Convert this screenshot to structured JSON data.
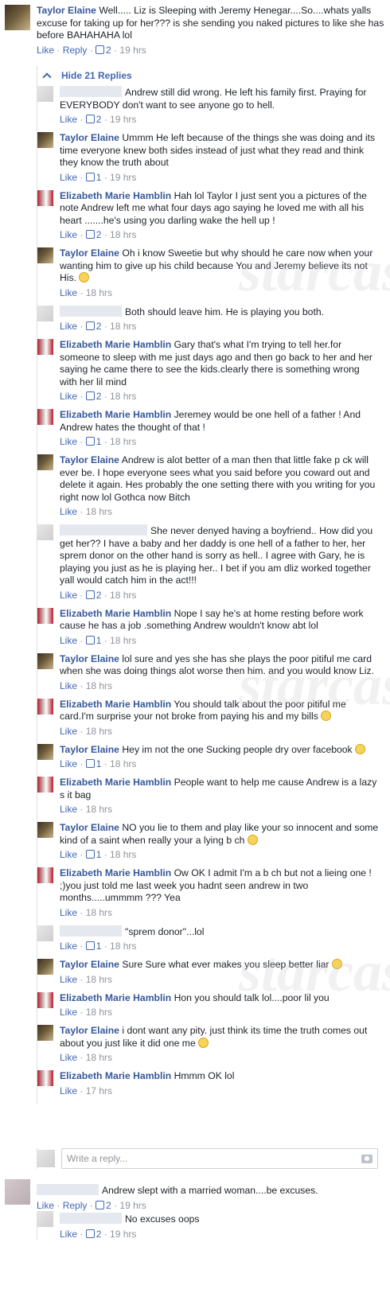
{
  "top_comment": {
    "author": "Taylor Elaine",
    "text": "Well..... Liz is Sleeping with Jeremy Henegar....So....whats yalls excuse for taking up for her??? is she sending you naked pictures to like she has before BAHAHAHA lol",
    "like": "Like",
    "reply": "Reply",
    "likes": "2",
    "time": "19 hrs"
  },
  "hide_replies": "Hide 21 Replies",
  "replies": [
    {
      "author": "",
      "blur": true,
      "text": "Andrew still did wrong. He left his family first. Praying for EVERYBODY don't want to see anyone go to hell.",
      "likes": "2",
      "time": "19 hrs"
    },
    {
      "author": "Taylor Elaine",
      "avatar": "taylor",
      "text": "Ummm He left because of the things she was doing and its time everyone knew both sides instead of just what they read and think they know the truth about",
      "likes": "1",
      "time": "19 hrs"
    },
    {
      "author": "Elizabeth Marie Hamblin",
      "avatar": "eliz",
      "text": "Hah lol Taylor I just sent you a pictures of the note Andrew left me what four days ago saying he loved me with all his heart .......he's using you darling wake the hell up !",
      "likes": "2",
      "time": "18 hrs"
    },
    {
      "author": "Taylor Elaine",
      "avatar": "taylor",
      "text": "Oh i know Sweetie but why should he care now when your wanting him to give up his child because You and Jeremy believe its not His.",
      "emoji": true,
      "likes": "",
      "time": "18 hrs"
    },
    {
      "author": "",
      "blur": true,
      "text": "Both should leave him. He is playing you both.",
      "likes": "2",
      "time": "18 hrs"
    },
    {
      "author": "Elizabeth Marie Hamblin",
      "avatar": "eliz",
      "text": "Gary that's what I'm trying to tell her.for someone to sleep with me just days ago and then go back to her and her saying he came there to see the kids.clearly there is something wrong with her lil mind",
      "likes": "2",
      "time": "18 hrs"
    },
    {
      "author": "Elizabeth Marie Hamblin",
      "avatar": "eliz",
      "text": "Jeremey would be one hell of a father ! And Andrew hates the thought of that !",
      "likes": "1",
      "time": "18 hrs"
    },
    {
      "author": "Taylor Elaine",
      "avatar": "taylor",
      "text": "Andrew is alot better of a man then that little fake p ck will ever be. I hope everyone sees what you said before you coward out and delete it again. Hes probably the one setting there with you writing for you right now lol Gothca now Bitch",
      "likes": "",
      "time": "18 hrs"
    },
    {
      "author": "",
      "blur": true,
      "wide": true,
      "text": "She never denyed having a boyfriend.. How did you get her?? I have a baby and her daddy is one hell of a father to her, her sprem donor on the other hand is sorry as hell.. I agree with Gary, he is playing you just as he is playing her.. I bet if you am dliz worked together yall would catch him in the act!!!",
      "likes": "2",
      "time": "18 hrs"
    },
    {
      "author": "Elizabeth Marie Hamblin",
      "avatar": "eliz",
      "text": "Nope I say he's at home resting before work cause he has a job .something Andrew wouldn't know abt lol",
      "likes": "1",
      "time": "18 hrs"
    },
    {
      "author": "Taylor Elaine",
      "avatar": "taylor",
      "text": "lol sure and yes she has she plays the poor pitiful me card when she was doing things alot worse then him. and you would know Liz.",
      "likes": "",
      "time": "18 hrs"
    },
    {
      "author": "Elizabeth Marie Hamblin",
      "avatar": "eliz",
      "text": "You should talk about the poor pitiful me card.I'm surprise your not broke from paying his and my bills",
      "emoji": true,
      "likes": "",
      "time": "18 hrs"
    },
    {
      "author": "Taylor Elaine",
      "avatar": "taylor",
      "text": "Hey im not the one Sucking people dry over facebook",
      "emoji": true,
      "likes": "1",
      "time": "18 hrs"
    },
    {
      "author": "Elizabeth Marie Hamblin",
      "avatar": "eliz",
      "text": "People want to help me cause Andrew is a lazy s it bag",
      "likes": "",
      "time": "18 hrs"
    },
    {
      "author": "Taylor Elaine",
      "avatar": "taylor",
      "text": "NO you lie to them and play like your so innocent and some kind of a saint when really your a lying b ch",
      "emoji": true,
      "likes": "1",
      "time": "18 hrs"
    },
    {
      "author": "Elizabeth Marie Hamblin",
      "avatar": "eliz",
      "text": "Ow OK I admit I'm a b ch but not a lieing one ! ;)you just told me last week you hadnt seen andrew in two months.....ummmm ??? Yea",
      "likes": "",
      "time": "18 hrs"
    },
    {
      "author": "",
      "blur": true,
      "text": "\"sprem donor\"...lol",
      "likes": "1",
      "time": "18 hrs"
    },
    {
      "author": "Taylor Elaine",
      "avatar": "taylor",
      "text": "Sure Sure what ever makes you sleep better liar",
      "emoji": true,
      "likes": "",
      "time": "18 hrs"
    },
    {
      "author": "Elizabeth Marie Hamblin",
      "avatar": "eliz",
      "text": "Hon you should talk lol....poor lil you",
      "likes": "",
      "time": "18 hrs"
    },
    {
      "author": "Taylor Elaine",
      "avatar": "taylor",
      "text": "i dont want any pity. just think its time the truth comes out about you just like it did one me",
      "emoji": true,
      "likes": "",
      "time": "18 hrs"
    },
    {
      "author": "Elizabeth Marie Hamblin",
      "avatar": "eliz",
      "text": "Hmmm OK lol",
      "likes": "",
      "time": "17 hrs"
    }
  ],
  "reply_placeholder": "Write a reply...",
  "bottom_comment": {
    "text": "Andrew slept with a married woman....be excuses.",
    "like": "Like",
    "reply": "Reply",
    "likes": "2",
    "time": "19 hrs"
  },
  "bottom_reply": {
    "text": "No excuses oops",
    "like": "Like",
    "likes": "2",
    "time": "19 hrs"
  },
  "labels": {
    "like": "Like",
    "dot": "·"
  },
  "watermark": "starcasm",
  "colors": {
    "link": "#365899",
    "action": "#4267b2",
    "meta": "#90949c"
  }
}
